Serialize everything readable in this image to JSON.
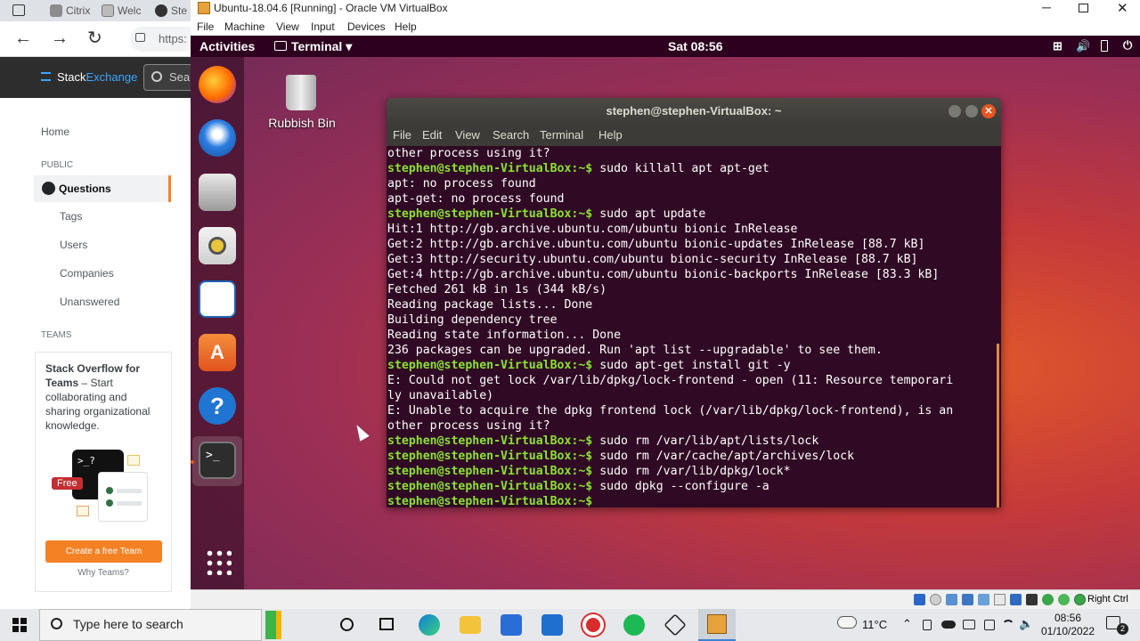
{
  "browser": {
    "tabs": [
      "Citrix",
      "Welc",
      "Ste"
    ],
    "url_text": "https:",
    "se_logo_stack": "Stack",
    "se_logo_exchange": "Exchange",
    "search_placeholder": "Sea",
    "nav": {
      "home": "Home",
      "public_heading": "PUBLIC",
      "questions": "Questions",
      "tags": "Tags",
      "users": "Users",
      "companies": "Companies",
      "unanswered": "Unanswered",
      "teams_heading": "TEAMS"
    },
    "teams": {
      "title": "Stack Overflow for Teams",
      "dash": " – ",
      "text": "Start collaborating and sharing organizational knowledge.",
      "free_badge": "Free",
      "terminal_glyph": ">_?",
      "create_button": "Create a free Team",
      "why_link": "Why Teams?"
    }
  },
  "vbox": {
    "title": "Ubuntu-18.04.6 [Running] - Oracle VM VirtualBox",
    "menu": [
      "File",
      "Machine",
      "View",
      "Input",
      "Devices",
      "Help"
    ],
    "right_ctrl": "Right Ctrl"
  },
  "ubuntu": {
    "activities": "Activities",
    "app_menu": "Terminal ▾",
    "clock": "Sat 08:56",
    "desktop_icon_label": "Rubbish Bin",
    "terminal": {
      "title": "stephen@stephen-VirtualBox: ~",
      "menu": [
        "File",
        "Edit",
        "View",
        "Search",
        "Terminal",
        "Help"
      ],
      "prompt": "stephen@stephen-VirtualBox:~$",
      "lines": [
        {
          "p": "",
          "t": "other process using it?"
        },
        {
          "p": "stephen@stephen-VirtualBox:~$",
          "t": " sudo killall apt apt-get"
        },
        {
          "p": "",
          "t": "apt: no process found"
        },
        {
          "p": "",
          "t": "apt-get: no process found"
        },
        {
          "p": "stephen@stephen-VirtualBox:~$",
          "t": " sudo apt update"
        },
        {
          "p": "",
          "t": "Hit:1 http://gb.archive.ubuntu.com/ubuntu bionic InRelease"
        },
        {
          "p": "",
          "t": "Get:2 http://gb.archive.ubuntu.com/ubuntu bionic-updates InRelease [88.7 kB]"
        },
        {
          "p": "",
          "t": "Get:3 http://security.ubuntu.com/ubuntu bionic-security InRelease [88.7 kB]"
        },
        {
          "p": "",
          "t": "Get:4 http://gb.archive.ubuntu.com/ubuntu bionic-backports InRelease [83.3 kB]"
        },
        {
          "p": "",
          "t": "Fetched 261 kB in 1s (344 kB/s)"
        },
        {
          "p": "",
          "t": "Reading package lists... Done"
        },
        {
          "p": "",
          "t": "Building dependency tree"
        },
        {
          "p": "",
          "t": "Reading state information... Done"
        },
        {
          "p": "",
          "t": "236 packages can be upgraded. Run 'apt list --upgradable' to see them."
        },
        {
          "p": "stephen@stephen-VirtualBox:~$",
          "t": " sudo apt-get install git -y"
        },
        {
          "p": "",
          "t": "E: Could not get lock /var/lib/dpkg/lock-frontend - open (11: Resource temporari"
        },
        {
          "p": "",
          "t": "ly unavailable)"
        },
        {
          "p": "",
          "t": "E: Unable to acquire the dpkg frontend lock (/var/lib/dpkg/lock-frontend), is an"
        },
        {
          "p": "",
          "t": "other process using it?"
        },
        {
          "p": "stephen@stephen-VirtualBox:~$",
          "t": " sudo rm /var/lib/apt/lists/lock"
        },
        {
          "p": "stephen@stephen-VirtualBox:~$",
          "t": " sudo rm /var/cache/apt/archives/lock"
        },
        {
          "p": "stephen@stephen-VirtualBox:~$",
          "t": " sudo rm /var/lib/dpkg/lock*"
        },
        {
          "p": "stephen@stephen-VirtualBox:~$",
          "t": " sudo dpkg --configure -a"
        },
        {
          "p": "stephen@stephen-VirtualBox:~$",
          "t": " "
        }
      ]
    }
  },
  "taskbar": {
    "search_placeholder": "Type here to search",
    "weather": "11°C",
    "time": "08:56",
    "date": "01/10/2022",
    "notifications": "2"
  },
  "colors": {
    "prompt": "#8ae234",
    "terminal_bg": "#300a24",
    "ubuntu_topbar": "#2c001e",
    "so_orange": "#f48225"
  }
}
